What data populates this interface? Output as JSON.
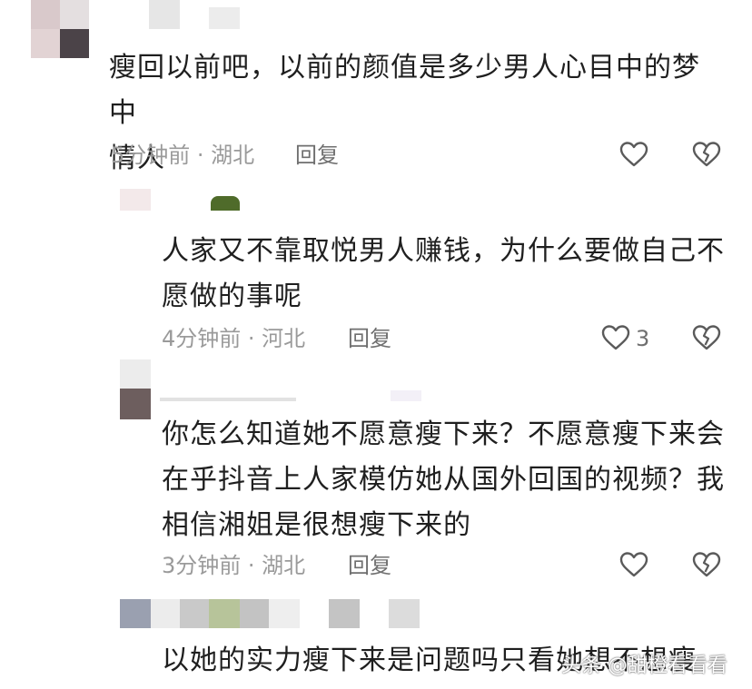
{
  "comments": [
    {
      "text": "瘦回以前吧，以前的颜值是多少男人心目中的梦中\n情人",
      "time": "5分钟前",
      "location": "湖北",
      "reply_label": "回复",
      "like_count": ""
    },
    {
      "text": "人家又不靠取悦男人赚钱，为什么要做自己不\n愿做的事呢",
      "time": "4分钟前",
      "location": "河北",
      "reply_label": "回复",
      "like_count": "3"
    },
    {
      "text": "你怎么知道她不愿意瘦下来？不愿意瘦下来会\n在乎抖音上人家模仿她从国外回国的视频？我\n相信湘姐是很想瘦下来的",
      "time": "3分钟前",
      "location": "湖北",
      "reply_label": "回复",
      "like_count": ""
    },
    {
      "text": "以她的实力瘦下来是问题吗只看她想不想瘦"
    }
  ],
  "meta_separator": " · ",
  "watermark": "头条 @甜橙看看看",
  "icons": {
    "like": "heart-outline-icon",
    "dislike": "broken-heart-icon"
  },
  "colors": {
    "text": "#1f1f1f",
    "meta": "#9a9a9a",
    "icon": "#5a5a5a"
  }
}
